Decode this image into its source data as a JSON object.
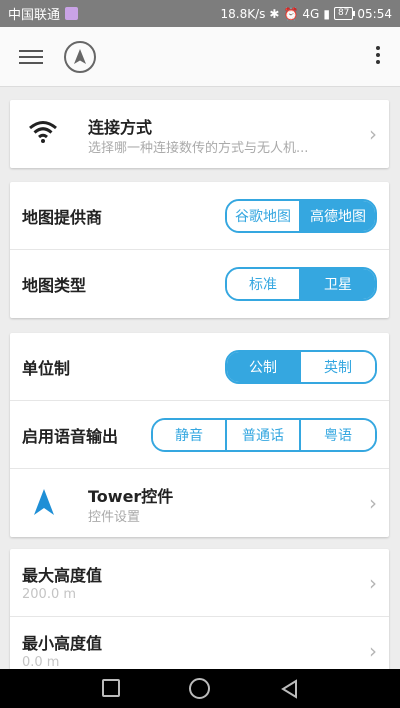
{
  "status_bar": {
    "carrier": "中国联通",
    "net_speed": "18.8K/s",
    "network": "4G",
    "battery": "87",
    "time": "05:54"
  },
  "toolbar": {
    "menu_icon": "menu-icon",
    "logo_icon": "compass-logo-icon",
    "more_icon": "more-vert-icon"
  },
  "connection": {
    "icon": "wifi-icon",
    "title": "连接方式",
    "subtitle": "选择哪一种连接数传的方式与无人机..."
  },
  "map_provider": {
    "label": "地图提供商",
    "options": [
      "谷歌地图",
      "高德地图"
    ],
    "selected": "高德地图"
  },
  "map_type": {
    "label": "地图类型",
    "options": [
      "标准",
      "卫星"
    ],
    "selected": "卫星"
  },
  "unit_system": {
    "label": "单位制",
    "options": [
      "公制",
      "英制"
    ],
    "selected": "公制"
  },
  "voice_output": {
    "label": "启用语音输出",
    "options": [
      "静音",
      "普通话",
      "粤语"
    ],
    "selected": ""
  },
  "tower_widgets": {
    "icon": "navigation-arrow-icon",
    "title": "Tower控件",
    "subtitle": "控件设置"
  },
  "max_altitude": {
    "title": "最大高度值",
    "value": "200.0 m"
  },
  "min_altitude": {
    "title": "最小高度值",
    "value": "0.0 m"
  },
  "colors": {
    "accent": "#35a7e0",
    "background": "#ededed",
    "status_bar": "#7d7d7d"
  }
}
